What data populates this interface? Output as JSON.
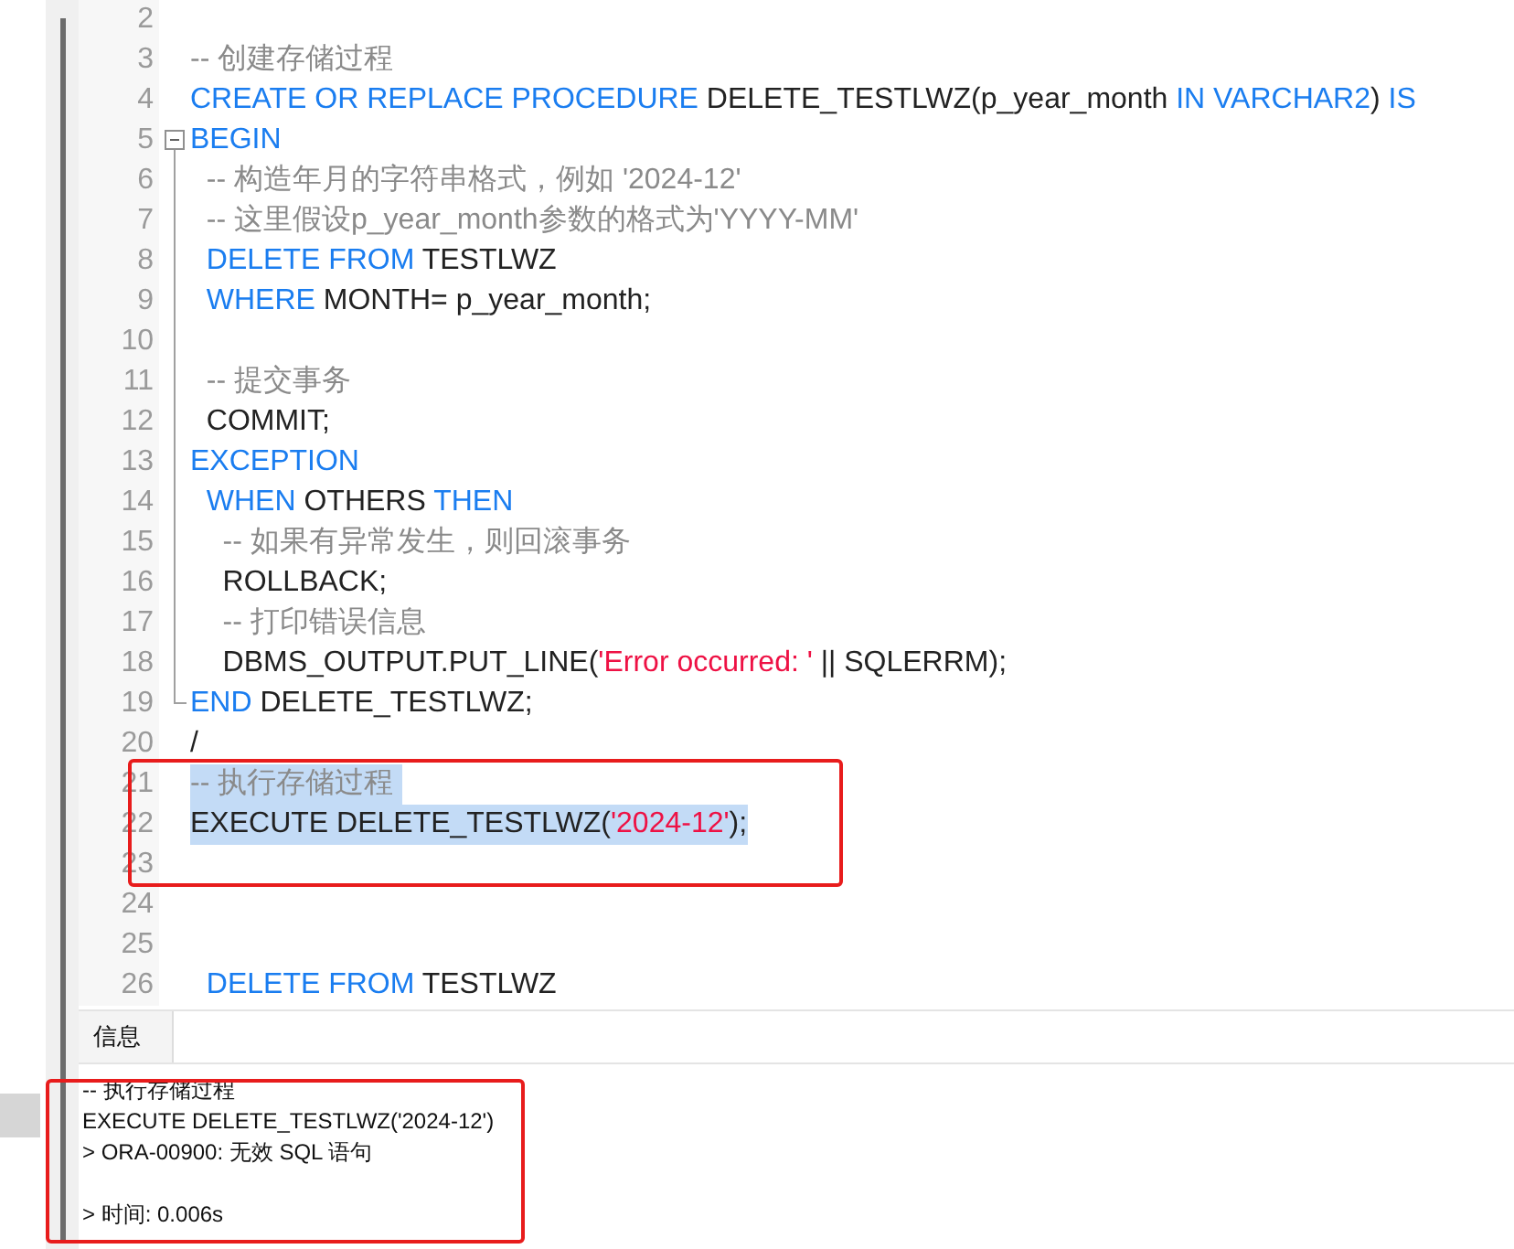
{
  "editor": {
    "lines": [
      {
        "number": "2",
        "selected": false
      },
      {
        "number": "3",
        "selected": false,
        "tokens": [
          {
            "kind": "comment",
            "text": "-- 创建存储过程"
          }
        ]
      },
      {
        "number": "4",
        "selected": false,
        "tokens": [
          {
            "kind": "keyword",
            "text": "CREATE OR REPLACE PROCEDURE"
          },
          {
            "kind": "plain",
            "text": " DELETE_TESTLWZ(p_year_month "
          },
          {
            "kind": "keyword",
            "text": "IN VARCHAR2"
          },
          {
            "kind": "plain",
            "text": ") "
          },
          {
            "kind": "keyword",
            "text": "IS"
          }
        ]
      },
      {
        "number": "5",
        "selected": false,
        "expanded": true,
        "tokens": [
          {
            "kind": "keyword",
            "text": "BEGIN"
          }
        ],
        "children": [
          {
            "number": "6",
            "selected": false,
            "tokens": [
              {
                "kind": "comment",
                "text": "  -- 构造年月的字符串格式，例如 '2024-12'"
              }
            ]
          },
          {
            "number": "7",
            "selected": false,
            "tokens": [
              {
                "kind": "comment",
                "text": "  -- 这里假设p_year_month参数的格式为'YYYY-MM'"
              }
            ]
          },
          {
            "number": "8",
            "selected": false,
            "tokens": [
              {
                "kind": "keyword",
                "text": "  DELETE FROM"
              },
              {
                "kind": "plain",
                "text": " TESTLWZ"
              }
            ]
          },
          {
            "number": "9",
            "selected": false,
            "tokens": [
              {
                "kind": "keyword",
                "text": "  WHERE"
              },
              {
                "kind": "plain",
                "text": " MONTH= p_year_month;"
              }
            ]
          },
          {
            "number": "10",
            "selected": false
          },
          {
            "number": "11",
            "selected": false,
            "tokens": [
              {
                "kind": "comment",
                "text": "  -- 提交事务"
              }
            ]
          },
          {
            "number": "12",
            "selected": false,
            "tokens": [
              {
                "kind": "plain",
                "text": "  COMMIT;"
              }
            ]
          },
          {
            "number": "13",
            "selected": false,
            "tokens": [
              {
                "kind": "keyword",
                "text": "EXCEPTION"
              }
            ]
          },
          {
            "number": "14",
            "selected": false,
            "tokens": [
              {
                "kind": "keyword",
                "text": "  WHEN"
              },
              {
                "kind": "plain",
                "text": " OTHERS "
              },
              {
                "kind": "keyword",
                "text": "THEN"
              }
            ]
          },
          {
            "number": "15",
            "selected": false,
            "tokens": [
              {
                "kind": "comment",
                "text": "    -- 如果有异常发生，则回滚事务"
              }
            ]
          },
          {
            "number": "16",
            "selected": false,
            "tokens": [
              {
                "kind": "plain",
                "text": "    ROLLBACK;"
              }
            ]
          },
          {
            "number": "17",
            "selected": false,
            "tokens": [
              {
                "kind": "comment",
                "text": "    -- 打印错误信息"
              }
            ]
          },
          {
            "number": "18",
            "selected": false,
            "tokens": [
              {
                "kind": "plain",
                "text": "    DBMS_OUTPUT.PUT_LINE("
              },
              {
                "kind": "string",
                "text": "'Error occurred: '"
              },
              {
                "kind": "plain",
                "text": " || SQLERRM);"
              }
            ]
          },
          {
            "number": "19",
            "selected": false,
            "tokens": [
              {
                "kind": "keyword",
                "text": "END"
              },
              {
                "kind": "plain",
                "text": " DELETE_TESTLWZ;"
              }
            ]
          }
        ]
      },
      {
        "number": "20",
        "selected": false,
        "tokens": [
          {
            "kind": "plain",
            "text": "/"
          }
        ]
      },
      {
        "number": "21",
        "selected": true,
        "tokens": [
          {
            "kind": "comment",
            "text": "-- 执行存储过程 "
          }
        ]
      },
      {
        "number": "22",
        "selected": true,
        "tokens": [
          {
            "kind": "plain",
            "text": "EXECUTE DELETE_TESTLWZ("
          },
          {
            "kind": "string",
            "text": "'2024-12'"
          },
          {
            "kind": "plain",
            "text": ");"
          }
        ]
      },
      {
        "number": "23",
        "selected": false
      },
      {
        "number": "24",
        "selected": false
      },
      {
        "number": "25",
        "selected": false
      },
      {
        "number": "26",
        "selected": false,
        "tokens": [
          {
            "kind": "keyword",
            "text": "  DELETE FROM"
          },
          {
            "kind": "plain",
            "text": " TESTLWZ"
          }
        ]
      }
    ]
  },
  "output_panel": {
    "tabs": [
      {
        "label": "信息",
        "selected": true
      }
    ],
    "lines": [
      {
        "kind": "echo",
        "text": "-- 执行存储过程"
      },
      {
        "kind": "echo",
        "text": "EXECUTE DELETE_TESTLWZ('2024-12')"
      },
      {
        "kind": "result",
        "text": "> ORA-00900: 无效 SQL 语句"
      },
      {
        "kind": "timing",
        "text": "> 时间: 0.006s"
      }
    ]
  }
}
